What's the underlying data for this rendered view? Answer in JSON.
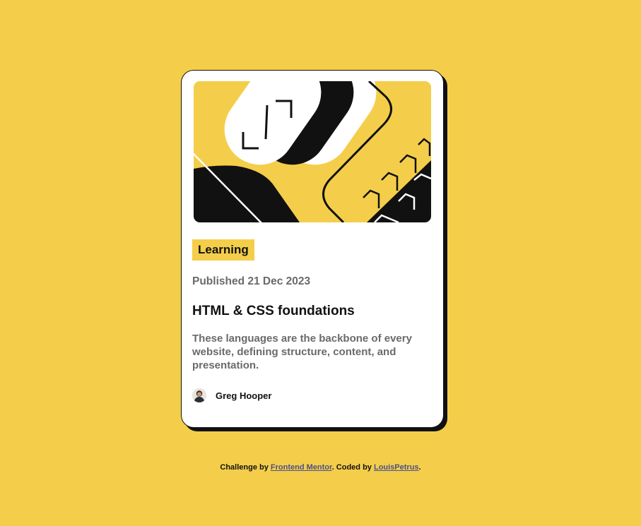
{
  "card": {
    "tag": "Learning",
    "published": "Published 21 Dec 2023",
    "title": "HTML & CSS foundations",
    "description": "These languages are the backbone of every website, defining structure, content, and presentation.",
    "author": {
      "name": "Greg Hooper",
      "avatar_icon": "avatar-photo"
    },
    "illustration_icon": "code-brackets-illustration"
  },
  "attribution": {
    "prefix": "Challenge by ",
    "link1": "Frontend Mentor",
    "middle": ". Coded by ",
    "link2": "LouisPetrus",
    "suffix": "."
  },
  "colors": {
    "background": "#f4ce4a",
    "card": "#ffffff",
    "text": "#111111",
    "muted": "#6a6a6a",
    "link": "#4a4f8e"
  }
}
